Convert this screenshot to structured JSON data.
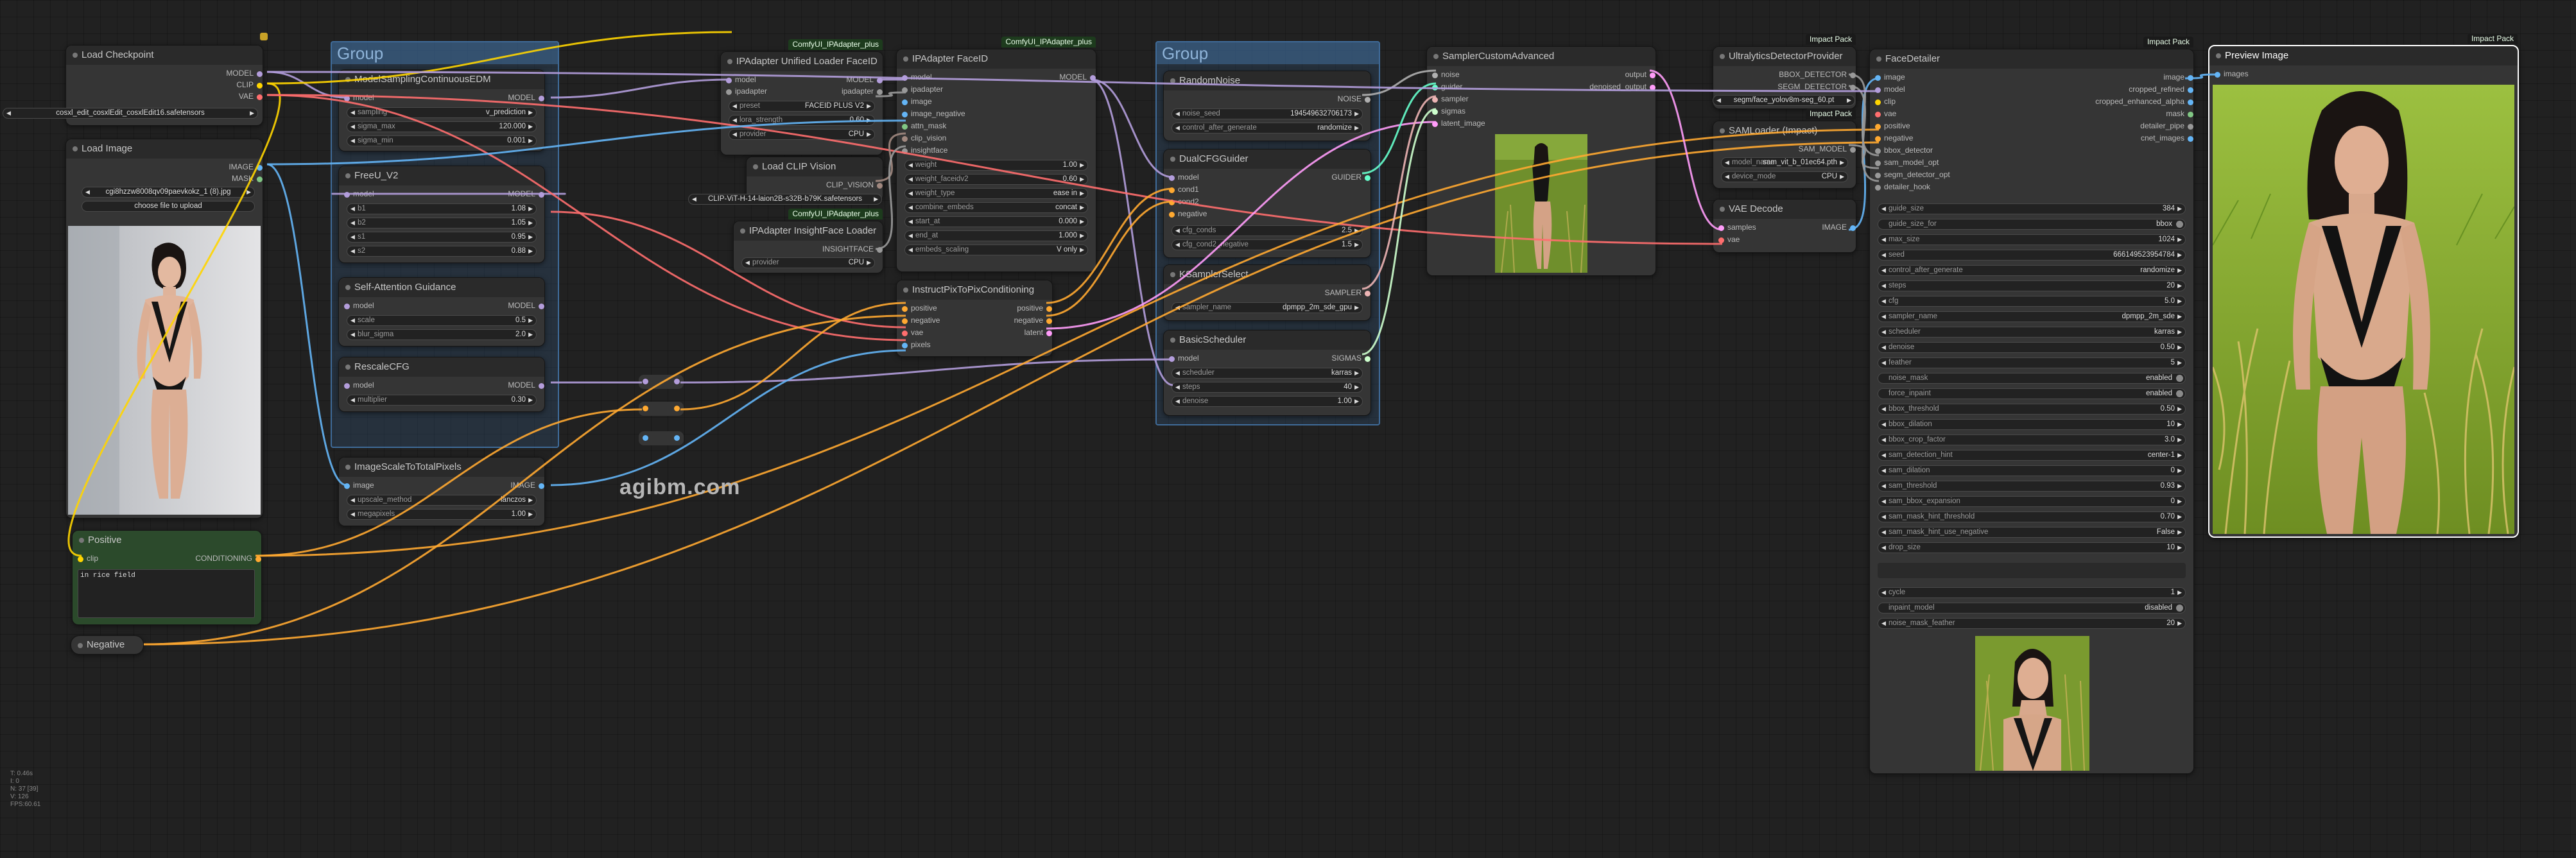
{
  "watermark": "agibm.com",
  "stats": [
    "T: 0.46s",
    "I: 0",
    "N: 37 [39]",
    "V: 126",
    "FPS:60.61"
  ],
  "groups": {
    "left": "Group",
    "right": "Group"
  },
  "nodes": {
    "load_checkpoint": {
      "title": "Load Checkpoint",
      "outputs": [
        "MODEL",
        "CLIP",
        "VAE"
      ],
      "ckpt_name": "cosxl_edit_cosxlEdit_cosxlEdit16.safetensors"
    },
    "load_image": {
      "title": "Load Image",
      "outputs": [
        "IMAGE",
        "MASK"
      ],
      "image": "cgi8hzzw8008qv09paevkokz_1 (8).jpg",
      "upload": "choose file to upload"
    },
    "positive": {
      "title": "Positive",
      "input": "clip",
      "output": "CONDITIONING",
      "text": "in rice field"
    },
    "negative": {
      "title": "Negative"
    },
    "model_sampling": {
      "title": "ModelSamplingContinuousEDM",
      "input": "model",
      "output": "MODEL",
      "w": [
        [
          "sampling",
          "v_prediction"
        ],
        [
          "sigma_max",
          "120.000"
        ],
        [
          "sigma_min",
          "0.001"
        ]
      ]
    },
    "freeu": {
      "title": "FreeU_V2",
      "input": "model",
      "output": "MODEL",
      "w": [
        [
          "b1",
          "1.08"
        ],
        [
          "b2",
          "1.05"
        ],
        [
          "s1",
          "0.95"
        ],
        [
          "s2",
          "0.88"
        ]
      ]
    },
    "sag": {
      "title": "Self-Attention Guidance",
      "input": "model",
      "output": "MODEL",
      "w": [
        [
          "scale",
          "0.5"
        ],
        [
          "blur_sigma",
          "2.0"
        ]
      ]
    },
    "rescale_cfg": {
      "title": "RescaleCFG",
      "input": "model",
      "output": "MODEL",
      "w": [
        [
          "multiplier",
          "0.30"
        ]
      ]
    },
    "image_scale": {
      "title": "ImageScaleToTotalPixels",
      "input": "image",
      "output": "IMAGE",
      "w": [
        [
          "upscale_method",
          "lanczos"
        ],
        [
          "megapixels",
          "1.00"
        ]
      ]
    },
    "ipa_loader": {
      "badge": "ComfyUI_IPAdapter_plus",
      "title": "IPAdapter Unified Loader FaceID",
      "inputs": [
        "model",
        "ipadapter"
      ],
      "outputs": [
        "MODEL",
        "ipadapter"
      ],
      "w": [
        [
          "preset",
          "FACEID PLUS V2"
        ],
        [
          "lora_strength",
          "0.60"
        ],
        [
          "provider",
          "CPU"
        ]
      ]
    },
    "clip_vision": {
      "title": "Load CLIP Vision",
      "output": "CLIP_VISION",
      "clip_name": "CLIP-ViT-H-14-laion2B-s32B-b79K.safetensors"
    },
    "insightface": {
      "badge": "ComfyUI_IPAdapter_plus",
      "title": "IPAdapter InsightFace Loader",
      "output": "INSIGHTFACE",
      "w": [
        [
          "provider",
          "CPU"
        ]
      ]
    },
    "ipa_faceid": {
      "badge": "ComfyUI_IPAdapter_plus",
      "title": "IPAdapter FaceID",
      "inputs": [
        "model",
        "ipadapter",
        "image",
        "image_negative",
        "attn_mask",
        "clip_vision",
        "insightface"
      ],
      "output": "MODEL",
      "w": [
        [
          "weight",
          "1.00"
        ],
        [
          "weight_faceidv2",
          "0.60"
        ],
        [
          "weight_type",
          "ease in"
        ],
        [
          "combine_embeds",
          "concat"
        ],
        [
          "start_at",
          "0.000"
        ],
        [
          "end_at",
          "1.000"
        ],
        [
          "embeds_scaling",
          "V only"
        ]
      ]
    },
    "ip2p": {
      "title": "InstructPixToPixConditioning",
      "inputs": [
        "positive",
        "negative",
        "vae",
        "pixels"
      ],
      "outputs": [
        "positive",
        "negative",
        "latent"
      ]
    },
    "random_noise": {
      "title": "RandomNoise",
      "output": "NOISE",
      "w": [
        [
          "noise_seed",
          "194549632706173"
        ],
        [
          "control_after_generate",
          "randomize"
        ]
      ]
    },
    "dual_cfg": {
      "title": "DualCFGGuider",
      "inputs": [
        "model",
        "cond1",
        "cond2",
        "negative"
      ],
      "output": "GUIDER",
      "w": [
        [
          "cfg_conds",
          "2.5"
        ],
        [
          "cfg_cond2_negative",
          "1.5"
        ]
      ]
    },
    "ksampler_select": {
      "title": "KSamplerSelect",
      "output": "SAMPLER",
      "w": [
        [
          "sampler_name",
          "dpmpp_2m_sde_gpu"
        ]
      ]
    },
    "basic_scheduler": {
      "title": "BasicScheduler",
      "input": "model",
      "output": "SIGMAS",
      "w": [
        [
          "scheduler",
          "karras"
        ],
        [
          "steps",
          "40"
        ],
        [
          "denoise",
          "1.00"
        ]
      ]
    },
    "sampler_custom": {
      "title": "SamplerCustomAdvanced",
      "inputs": [
        "noise",
        "guider",
        "sampler",
        "sigmas",
        "latent_image"
      ],
      "outputs": [
        "output",
        "denoised_output"
      ]
    },
    "ultralytics": {
      "badge": "Impact Pack",
      "title": "UltralyticsDetectorProvider",
      "outputs": [
        "BBOX_DETECTOR",
        "SEGM_DETECTOR"
      ],
      "model_name": "segm/face_yolov8m-seg_60.pt"
    },
    "sam_loader": {
      "badge": "Impact Pack",
      "title": "SAMLoader (Impact)",
      "output": "SAM_MODEL",
      "w": [
        [
          "model_name",
          "sam_vit_b_01ec64.pth"
        ],
        [
          "device_mode",
          "CPU"
        ]
      ]
    },
    "vae_decode": {
      "title": "VAE Decode",
      "inputs": [
        "samples",
        "vae"
      ],
      "output": "IMAGE"
    },
    "face_detailer": {
      "badge": "Impact Pack",
      "title": "FaceDetailer",
      "inputs": [
        "image",
        "model",
        "clip",
        "vae",
        "positive",
        "negative",
        "bbox_detector",
        "sam_model_opt",
        "segm_detector_opt",
        "detailer_hook"
      ],
      "outputs": [
        "image",
        "cropped_refined",
        "cropped_enhanced_alpha",
        "mask",
        "detailer_pipe",
        "cnet_images"
      ],
      "w": [
        [
          "guide_size",
          "384"
        ],
        [
          "guide_size_for",
          "bbox"
        ],
        [
          "max_size",
          "1024"
        ],
        [
          "seed",
          "666149523954784"
        ],
        [
          "control_after_generate",
          "randomize"
        ],
        [
          "steps",
          "20"
        ],
        [
          "cfg",
          "5.0"
        ],
        [
          "sampler_name",
          "dpmpp_2m_sde"
        ],
        [
          "scheduler",
          "karras"
        ],
        [
          "denoise",
          "0.50"
        ],
        [
          "feather",
          "5"
        ],
        [
          "noise_mask",
          "enabled"
        ],
        [
          "force_inpaint",
          "enabled"
        ],
        [
          "bbox_threshold",
          "0.50"
        ],
        [
          "bbox_dilation",
          "10"
        ],
        [
          "bbox_crop_factor",
          "3.0"
        ],
        [
          "sam_detection_hint",
          "center-1"
        ],
        [
          "sam_dilation",
          "0"
        ],
        [
          "sam_threshold",
          "0.93"
        ],
        [
          "sam_bbox_expansion",
          "0"
        ],
        [
          "sam_mask_hint_threshold",
          "0.70"
        ],
        [
          "sam_mask_hint_use_negative",
          "False"
        ],
        [
          "drop_size",
          "10"
        ]
      ],
      "w2": [
        [
          "cycle",
          "1"
        ],
        [
          "inpaint_model",
          "disabled"
        ],
        [
          "noise_mask_feather",
          "20"
        ]
      ]
    },
    "preview": {
      "badge": "Impact Pack",
      "title": "Preview Image",
      "input": "images"
    }
  }
}
